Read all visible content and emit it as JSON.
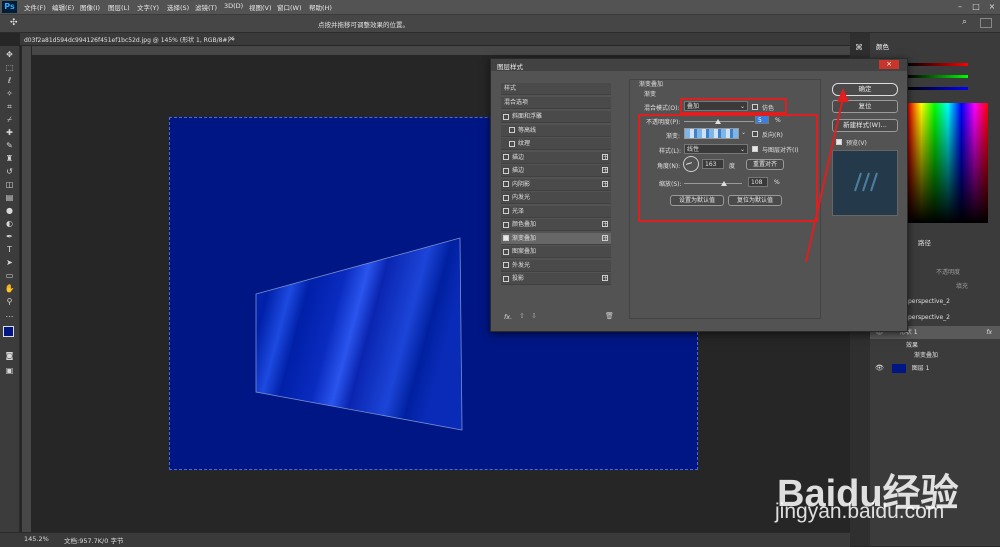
{
  "app": {
    "logo": "Ps",
    "status_message": "点按并拖移可调整效果的位置。"
  },
  "menu": [
    "文件(F)",
    "编辑(E)",
    "图像(I)",
    "图层(L)",
    "文字(Y)",
    "选择(S)",
    "滤镜(T)",
    "3D(D)",
    "视图(V)",
    "窗口(W)",
    "帮助(H)"
  ],
  "document": {
    "tab_title": "d03f2a81d594dc994126f451ef1bc52d.jpg @ 145% (形状 1, RGB/8#) *",
    "close": "×",
    "canvas_color": "#001684"
  },
  "status_bar": {
    "zoom": "145.2%",
    "doc_info": "文档:957.7K/0 字节"
  },
  "dialog": {
    "title": "图层样式",
    "styles_header": "样式",
    "blend_options": "混合选项",
    "items": [
      {
        "label": "斜面和浮雕",
        "checked": false,
        "plus": false,
        "sub": false
      },
      {
        "label": "等高线",
        "checked": false,
        "plus": false,
        "sub": true
      },
      {
        "label": "纹理",
        "checked": false,
        "plus": false,
        "sub": true
      },
      {
        "label": "描边",
        "checked": false,
        "plus": true,
        "sub": false
      },
      {
        "label": "描边",
        "checked": false,
        "plus": true,
        "sub": false
      },
      {
        "label": "内阴影",
        "checked": false,
        "plus": true,
        "sub": false
      },
      {
        "label": "内发光",
        "checked": false,
        "plus": false,
        "sub": false
      },
      {
        "label": "光泽",
        "checked": false,
        "plus": false,
        "sub": false
      },
      {
        "label": "颜色叠加",
        "checked": false,
        "plus": true,
        "sub": false
      },
      {
        "label": "渐变叠加",
        "checked": true,
        "plus": true,
        "sub": false
      },
      {
        "label": "图案叠加",
        "checked": false,
        "plus": false,
        "sub": false
      },
      {
        "label": "外发光",
        "checked": false,
        "plus": false,
        "sub": false
      },
      {
        "label": "投影",
        "checked": false,
        "plus": true,
        "sub": false
      }
    ],
    "fx_label": "fx.",
    "section_title": "渐变叠加",
    "section_sub": "渐变",
    "blend_mode_label": "混合模式(O):",
    "blend_mode_value": "叠加",
    "dither_label": "仿色",
    "opacity_label": "不透明度(P):",
    "opacity_value": "5",
    "opacity_unit": "%",
    "gradient_label": "渐变:",
    "reverse_label": "反向(R)",
    "style_label": "样式(L):",
    "style_value": "线性",
    "align_label": "与图层对齐(I)",
    "angle_label": "角度(N):",
    "angle_value": "163",
    "angle_unit": "度",
    "reset_align": "重置对齐",
    "scale_label": "缩放(S):",
    "scale_value": "108",
    "scale_unit": "%",
    "set_default": "设置为默认值",
    "reset_default": "复位为默认值",
    "ok": "确定",
    "reset": "复位",
    "new_style": "新建样式(W)...",
    "preview_label": "预览(V)"
  },
  "panels": {
    "color_tab": "颜色",
    "layers_tab": "路径",
    "opacity_label": "不透明度",
    "fill_label": "填充",
    "layers": [
      {
        "name": "perspective_2",
        "type": "text"
      },
      {
        "name": "perspective_2",
        "type": "text"
      },
      {
        "name": "形状 1",
        "type": "shape",
        "fx": "fx"
      },
      {
        "name": "效果",
        "type": "effects"
      },
      {
        "name": "渐变叠加",
        "type": "effect"
      },
      {
        "name": "图层 1",
        "type": "layer"
      }
    ]
  },
  "watermark": {
    "brand": "Baidu经验",
    "url": "jingyan.baidu.com"
  },
  "colors": {
    "accent_red": "#e01e1e",
    "canvas": "#001684",
    "dialog": "#535353"
  }
}
